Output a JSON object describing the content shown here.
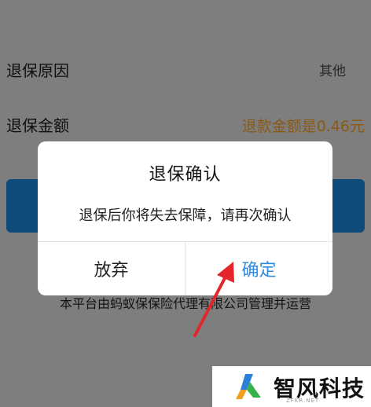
{
  "rows": [
    {
      "label": "退保原因",
      "value": "其他"
    },
    {
      "label": "退保金额",
      "value": "退款金额是0.46元"
    }
  ],
  "footnote": "本平台由蚂蚁保保险代理有限公司管理并运营",
  "dialog": {
    "title": "退保确认",
    "message": "退保后你将失去保障，请再次确认",
    "cancel_label": "放弃",
    "confirm_label": "确定"
  },
  "annotation": {
    "arrow_color": "#e3262c"
  },
  "watermark": {
    "text": "智风科技",
    "subtext": "ZFKR.NET"
  },
  "colors": {
    "confirm": "#2f8ae0",
    "amount": "#e8a040",
    "primary_button": "#1a8bf0"
  }
}
